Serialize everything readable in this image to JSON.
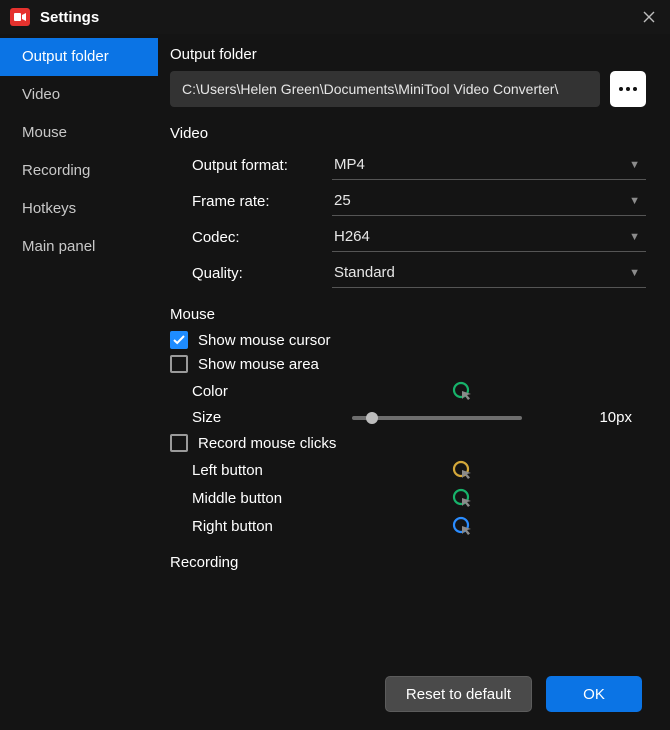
{
  "window": {
    "title": "Settings"
  },
  "sidebar": {
    "items": [
      {
        "label": "Output folder",
        "active": true
      },
      {
        "label": "Video"
      },
      {
        "label": "Mouse"
      },
      {
        "label": "Recording"
      },
      {
        "label": "Hotkeys"
      },
      {
        "label": "Main panel"
      }
    ]
  },
  "output": {
    "section_title": "Output folder",
    "path": "C:\\Users\\Helen Green\\Documents\\MiniTool Video Converter\\"
  },
  "video": {
    "section_title": "Video",
    "format_label": "Output format:",
    "format_value": "MP4",
    "framerate_label": "Frame rate:",
    "framerate_value": "25",
    "codec_label": "Codec:",
    "codec_value": "H264",
    "quality_label": "Quality:",
    "quality_value": "Standard"
  },
  "mouse": {
    "section_title": "Mouse",
    "show_cursor_label": "Show mouse cursor",
    "show_cursor_checked": true,
    "show_area_label": "Show mouse area",
    "show_area_checked": false,
    "color_label": "Color",
    "color_value": "#17b26a",
    "size_label": "Size",
    "size_value": "10px",
    "record_clicks_label": "Record mouse clicks",
    "record_clicks_checked": false,
    "left_label": "Left button",
    "left_color": "#d4a83a",
    "middle_label": "Middle button",
    "middle_color": "#17b26a",
    "right_label": "Right button",
    "right_color": "#2a8cff"
  },
  "recording": {
    "section_title": "Recording"
  },
  "footer": {
    "reset_label": "Reset to default",
    "ok_label": "OK"
  }
}
